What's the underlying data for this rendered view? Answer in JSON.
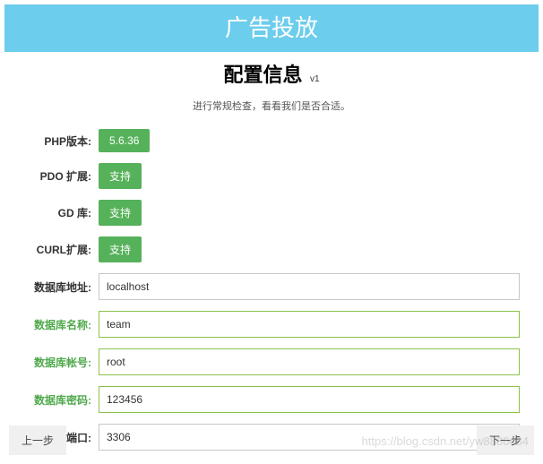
{
  "header": "广告投放",
  "title": "配置信息",
  "version": "v1",
  "subtitle": "进行常规检查，看看我们是否合适。",
  "checks": [
    {
      "label": "PHP版本:",
      "value": "5.6.36"
    },
    {
      "label": "PDO 扩展:",
      "value": "支持"
    },
    {
      "label": "GD 库:",
      "value": "支持"
    },
    {
      "label": "CURL扩展:",
      "value": "支持"
    }
  ],
  "fields": [
    {
      "label": "数据库地址:",
      "value": "localhost",
      "ok": false
    },
    {
      "label": "数据库名称:",
      "value": "team",
      "ok": true
    },
    {
      "label": "数据库帐号:",
      "value": "root",
      "ok": true
    },
    {
      "label": "数据库密码:",
      "value": "123456",
      "ok": true
    },
    {
      "label": "数据库端口:",
      "value": "3306",
      "ok": false
    }
  ],
  "nav": {
    "prev": "上一步",
    "next": "下一步"
  },
  "watermark": "https://blog.csdn.net/yw8886484"
}
